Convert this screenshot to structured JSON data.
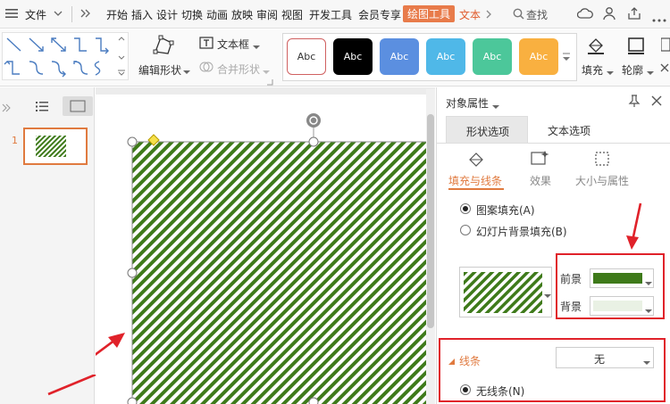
{
  "menubar": {
    "file_label": "文件",
    "tabs": [
      "开始",
      "插入",
      "设计",
      "切换",
      "动画",
      "放映",
      "审阅",
      "视图",
      "开发工具",
      "会员专享"
    ],
    "active_tab": "绘图工具",
    "text_tool_tab": "文本",
    "search_label": "查找"
  },
  "ribbon": {
    "edit_shape_label": "编辑形状",
    "text_box_label": "文本框",
    "merge_shape_label": "合并形状",
    "style_label": "Abc",
    "styles": [
      {
        "fill": "#ffffff",
        "text": "#333333",
        "border": "#d06060"
      },
      {
        "fill": "#000000",
        "text": "#ffffff",
        "border": "#000000"
      },
      {
        "fill": "#5b8fe0",
        "text": "#ffffff",
        "border": "#5b8fe0"
      },
      {
        "fill": "#4fb8e8",
        "text": "#ffffff",
        "border": "#4fb8e8"
      },
      {
        "fill": "#4cc79a",
        "text": "#ffffff",
        "border": "#4cc79a"
      },
      {
        "fill": "#f9b040",
        "text": "#ffffff",
        "border": "#f9b040"
      }
    ],
    "fill_label": "填充",
    "outline_label": "轮廓"
  },
  "thumbnails": {
    "slide_number": "1"
  },
  "panel": {
    "title": "对象属性",
    "tab_shape": "形状选项",
    "tab_text": "文本选项",
    "sub_fill_line": "填充与线条",
    "sub_effect": "效果",
    "sub_size": "大小与属性",
    "radio_pattern_fill": "图案填充(A)",
    "radio_slide_bg_fill": "幻灯片背景填充(B)",
    "foreground_label": "前景",
    "background_label": "背景",
    "foreground_color": "#3e7a1a",
    "background_color": "#e9f1e4",
    "line_section_label": "线条",
    "line_value": "无",
    "radio_no_line": "无线条(N)"
  },
  "colors": {
    "accent_orange": "#e07a3f",
    "highlight_red": "#e0222a",
    "pattern_green": "#3e7a1a"
  }
}
